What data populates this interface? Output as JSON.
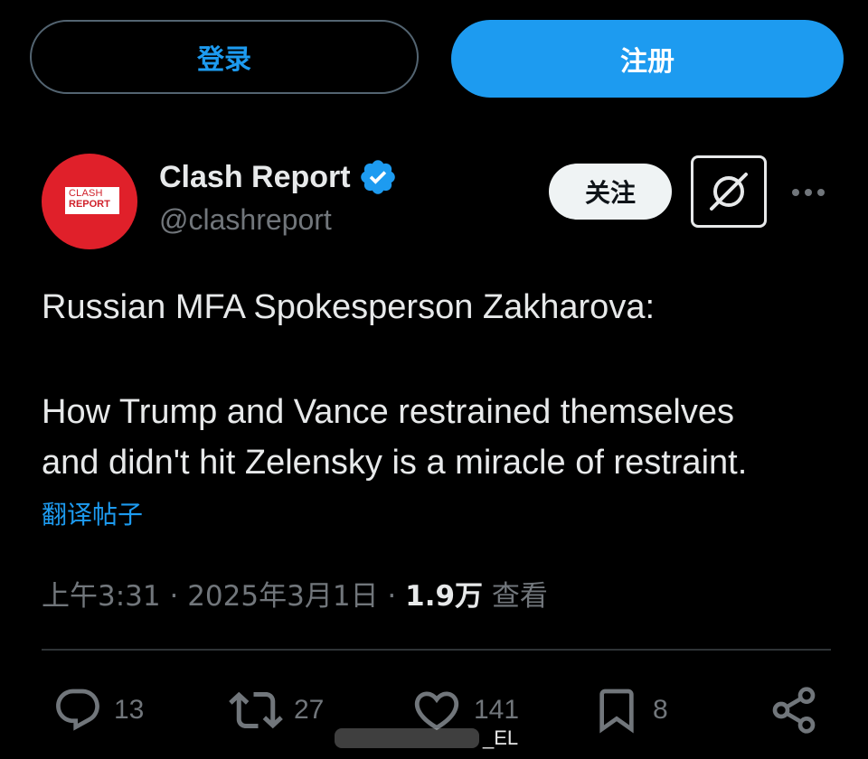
{
  "top_bar": {
    "login_label": "登录",
    "signup_label": "注册"
  },
  "author": {
    "avatar_line1": "CLASH",
    "avatar_line2": "REPORT",
    "display_name": "Clash Report",
    "handle": "@clashreport",
    "verified": true,
    "follow_label": "关注"
  },
  "tweet": {
    "paragraphs": [
      "Russian MFA Spokesperson Zakharova:",
      "How Trump and Vance restrained themselves",
      "and didn't hit Zelensky is a miracle of restraint."
    ],
    "translate_label": "翻译帖子",
    "time": "上午3:31",
    "date": "2025年3月1日",
    "separator": "·",
    "views_count": "1.9万",
    "views_label": "查看"
  },
  "actions": {
    "replies": "13",
    "reposts": "27",
    "likes": "141",
    "bookmarks": "8"
  },
  "watermark": {
    "text": "_EL"
  },
  "colors": {
    "background": "#000000",
    "accent": "#1d9bf0",
    "text_primary": "#e7e9ea",
    "text_secondary": "#71767b",
    "divider": "#2f3336",
    "avatar_red": "#e0202a"
  },
  "icons": {
    "verified": "verified-badge-icon",
    "grok": "grok-icon",
    "more": "more-horizontal-icon",
    "reply": "reply-icon",
    "repost": "repost-icon",
    "like": "heart-icon",
    "bookmark": "bookmark-icon",
    "share": "share-icon"
  }
}
